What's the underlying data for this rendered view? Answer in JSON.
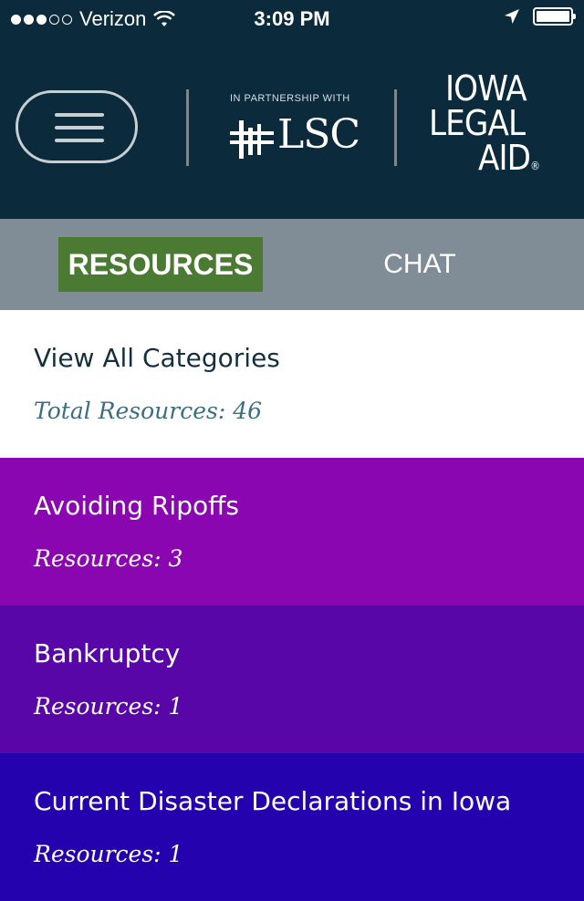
{
  "status_bar": {
    "carrier": "Verizon",
    "time": "3:09 PM",
    "signal_bars_filled": 3,
    "signal_bars_total": 5,
    "battery_level": 1.0
  },
  "header": {
    "partnership_label": "IN PARTNERSHIP WITH",
    "partner_name": "LSC",
    "brand_line1": "IOWA",
    "brand_line2": "LEGAL",
    "brand_line3": "AID",
    "registered_mark": "®"
  },
  "tabs": {
    "resources_label": "RESOURCES",
    "chat_label": "CHAT"
  },
  "list": {
    "all": {
      "title": "View All Categories",
      "count": "Total Resources: 46"
    },
    "categories": [
      {
        "title": "Avoiding Ripoffs",
        "count": "Resources: 3",
        "color": "#8a06b0"
      },
      {
        "title": "Bankruptcy",
        "count": "Resources: 1",
        "color": "#5806a8"
      },
      {
        "title": "Current Disaster Declarations in Iowa",
        "count": "Resources: 1",
        "color": "#2403ae"
      }
    ]
  },
  "colors": {
    "header_bg": "#0b2a3c",
    "tab_bar_bg": "#808c96",
    "active_tab_bg": "#4b7a33"
  }
}
